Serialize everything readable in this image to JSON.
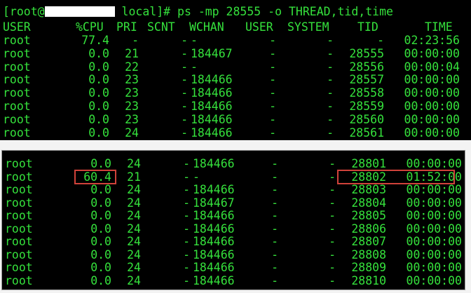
{
  "terminal": {
    "prompt_user": "[root@",
    "prompt_rest": " local]# ps -mp 28555 -o THREAD,tid,time",
    "headers": {
      "user": "USER",
      "cpu": "%CPU",
      "pri": "PRI",
      "scnt": "SCNT",
      "wchan": "WCHAN",
      "user2": "USER",
      "system": "SYSTEM",
      "tid": "TID",
      "time": "TIME"
    },
    "top_rows": [
      {
        "user": "root",
        "cpu": "77.4",
        "pri": "-",
        "scnt": "-",
        "wchan": "-",
        "user2": "-",
        "system": "-",
        "tid": "-",
        "time": "02:23:56"
      },
      {
        "user": "root",
        "cpu": "0.0",
        "pri": "21",
        "scnt": "-",
        "wchan": "184467",
        "user2": "-",
        "system": "-",
        "tid": "28555",
        "time": "00:00:00"
      },
      {
        "user": "root",
        "cpu": "0.0",
        "pri": "22",
        "scnt": "-",
        "wchan": "-",
        "user2": "-",
        "system": "-",
        "tid": "28556",
        "time": "00:00:04"
      },
      {
        "user": "root",
        "cpu": "0.0",
        "pri": "23",
        "scnt": "-",
        "wchan": "184466",
        "user2": "-",
        "system": "-",
        "tid": "28557",
        "time": "00:00:00"
      },
      {
        "user": "root",
        "cpu": "0.0",
        "pri": "23",
        "scnt": "-",
        "wchan": "184466",
        "user2": "-",
        "system": "-",
        "tid": "28558",
        "time": "00:00:00"
      },
      {
        "user": "root",
        "cpu": "0.0",
        "pri": "23",
        "scnt": "-",
        "wchan": "184466",
        "user2": "-",
        "system": "-",
        "tid": "28559",
        "time": "00:00:00"
      },
      {
        "user": "root",
        "cpu": "0.0",
        "pri": "23",
        "scnt": "-",
        "wchan": "184466",
        "user2": "-",
        "system": "-",
        "tid": "28560",
        "time": "00:00:00"
      },
      {
        "user": "root",
        "cpu": "0.0",
        "pri": "24",
        "scnt": "-",
        "wchan": "184466",
        "user2": "-",
        "system": "-",
        "tid": "28561",
        "time": "00:00:00"
      }
    ],
    "bottom_rows": [
      {
        "user": "root",
        "cpu": "0.0",
        "pri": "24",
        "scnt": "-",
        "wchan": "184466",
        "user2": "-",
        "system": "-",
        "tid": "28801",
        "time": "00:00:00"
      },
      {
        "user": "root",
        "cpu": "60.4",
        "pri": "21",
        "scnt": "-",
        "wchan": "-",
        "user2": "-",
        "system": "-",
        "tid": "28802",
        "time": "01:52:00"
      },
      {
        "user": "root",
        "cpu": "0.0",
        "pri": "24",
        "scnt": "-",
        "wchan": "184466",
        "user2": "-",
        "system": "-",
        "tid": "28803",
        "time": "00:00:00"
      },
      {
        "user": "root",
        "cpu": "0.0",
        "pri": "24",
        "scnt": "-",
        "wchan": "184467",
        "user2": "-",
        "system": "-",
        "tid": "28804",
        "time": "00:00:00"
      },
      {
        "user": "root",
        "cpu": "0.0",
        "pri": "24",
        "scnt": "-",
        "wchan": "184466",
        "user2": "-",
        "system": "-",
        "tid": "28805",
        "time": "00:00:00"
      },
      {
        "user": "root",
        "cpu": "0.0",
        "pri": "24",
        "scnt": "-",
        "wchan": "184466",
        "user2": "-",
        "system": "-",
        "tid": "28806",
        "time": "00:00:00"
      },
      {
        "user": "root",
        "cpu": "0.0",
        "pri": "24",
        "scnt": "-",
        "wchan": "184466",
        "user2": "-",
        "system": "-",
        "tid": "28807",
        "time": "00:00:00"
      },
      {
        "user": "root",
        "cpu": "0.0",
        "pri": "24",
        "scnt": "-",
        "wchan": "184466",
        "user2": "-",
        "system": "-",
        "tid": "28808",
        "time": "00:00:00"
      },
      {
        "user": "root",
        "cpu": "0.0",
        "pri": "24",
        "scnt": "-",
        "wchan": "184466",
        "user2": "-",
        "system": "-",
        "tid": "28809",
        "time": "00:00:00"
      },
      {
        "user": "root",
        "cpu": "0.0",
        "pri": "24",
        "scnt": "-",
        "wchan": "184466",
        "user2": "-",
        "system": "-",
        "tid": "28810",
        "time": "00:00:00"
      }
    ],
    "highlight": {
      "row_index": 1,
      "color": "#d0423a"
    }
  },
  "colors": {
    "terminal_bg": "#000000",
    "terminal_fg": "#35e13c",
    "page_bg": "#f3f3f3"
  }
}
